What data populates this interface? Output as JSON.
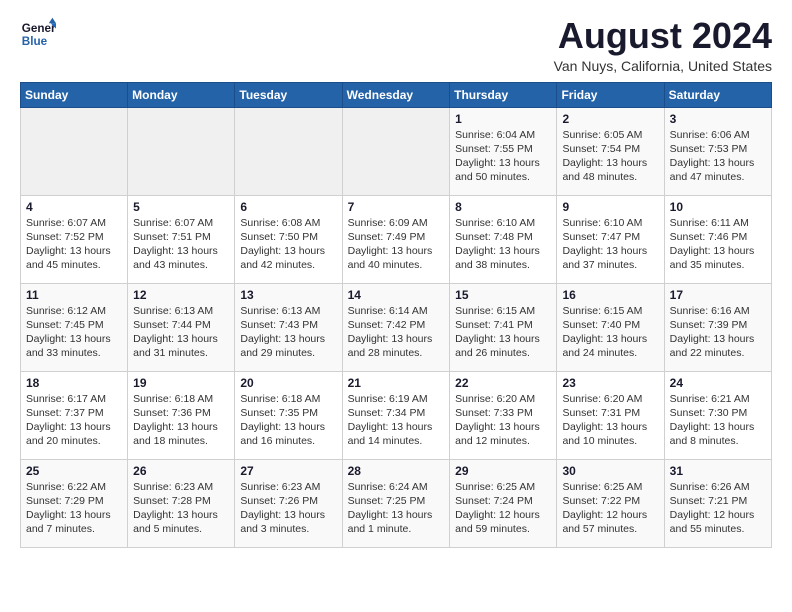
{
  "logo": {
    "line1": "General",
    "line2": "Blue"
  },
  "header": {
    "month": "August 2024",
    "location": "Van Nuys, California, United States"
  },
  "weekdays": [
    "Sunday",
    "Monday",
    "Tuesday",
    "Wednesday",
    "Thursday",
    "Friday",
    "Saturday"
  ],
  "weeks": [
    [
      {
        "day": "",
        "info": ""
      },
      {
        "day": "",
        "info": ""
      },
      {
        "day": "",
        "info": ""
      },
      {
        "day": "",
        "info": ""
      },
      {
        "day": "1",
        "info": "Sunrise: 6:04 AM\nSunset: 7:55 PM\nDaylight: 13 hours\nand 50 minutes."
      },
      {
        "day": "2",
        "info": "Sunrise: 6:05 AM\nSunset: 7:54 PM\nDaylight: 13 hours\nand 48 minutes."
      },
      {
        "day": "3",
        "info": "Sunrise: 6:06 AM\nSunset: 7:53 PM\nDaylight: 13 hours\nand 47 minutes."
      }
    ],
    [
      {
        "day": "4",
        "info": "Sunrise: 6:07 AM\nSunset: 7:52 PM\nDaylight: 13 hours\nand 45 minutes."
      },
      {
        "day": "5",
        "info": "Sunrise: 6:07 AM\nSunset: 7:51 PM\nDaylight: 13 hours\nand 43 minutes."
      },
      {
        "day": "6",
        "info": "Sunrise: 6:08 AM\nSunset: 7:50 PM\nDaylight: 13 hours\nand 42 minutes."
      },
      {
        "day": "7",
        "info": "Sunrise: 6:09 AM\nSunset: 7:49 PM\nDaylight: 13 hours\nand 40 minutes."
      },
      {
        "day": "8",
        "info": "Sunrise: 6:10 AM\nSunset: 7:48 PM\nDaylight: 13 hours\nand 38 minutes."
      },
      {
        "day": "9",
        "info": "Sunrise: 6:10 AM\nSunset: 7:47 PM\nDaylight: 13 hours\nand 37 minutes."
      },
      {
        "day": "10",
        "info": "Sunrise: 6:11 AM\nSunset: 7:46 PM\nDaylight: 13 hours\nand 35 minutes."
      }
    ],
    [
      {
        "day": "11",
        "info": "Sunrise: 6:12 AM\nSunset: 7:45 PM\nDaylight: 13 hours\nand 33 minutes."
      },
      {
        "day": "12",
        "info": "Sunrise: 6:13 AM\nSunset: 7:44 PM\nDaylight: 13 hours\nand 31 minutes."
      },
      {
        "day": "13",
        "info": "Sunrise: 6:13 AM\nSunset: 7:43 PM\nDaylight: 13 hours\nand 29 minutes."
      },
      {
        "day": "14",
        "info": "Sunrise: 6:14 AM\nSunset: 7:42 PM\nDaylight: 13 hours\nand 28 minutes."
      },
      {
        "day": "15",
        "info": "Sunrise: 6:15 AM\nSunset: 7:41 PM\nDaylight: 13 hours\nand 26 minutes."
      },
      {
        "day": "16",
        "info": "Sunrise: 6:15 AM\nSunset: 7:40 PM\nDaylight: 13 hours\nand 24 minutes."
      },
      {
        "day": "17",
        "info": "Sunrise: 6:16 AM\nSunset: 7:39 PM\nDaylight: 13 hours\nand 22 minutes."
      }
    ],
    [
      {
        "day": "18",
        "info": "Sunrise: 6:17 AM\nSunset: 7:37 PM\nDaylight: 13 hours\nand 20 minutes."
      },
      {
        "day": "19",
        "info": "Sunrise: 6:18 AM\nSunset: 7:36 PM\nDaylight: 13 hours\nand 18 minutes."
      },
      {
        "day": "20",
        "info": "Sunrise: 6:18 AM\nSunset: 7:35 PM\nDaylight: 13 hours\nand 16 minutes."
      },
      {
        "day": "21",
        "info": "Sunrise: 6:19 AM\nSunset: 7:34 PM\nDaylight: 13 hours\nand 14 minutes."
      },
      {
        "day": "22",
        "info": "Sunrise: 6:20 AM\nSunset: 7:33 PM\nDaylight: 13 hours\nand 12 minutes."
      },
      {
        "day": "23",
        "info": "Sunrise: 6:20 AM\nSunset: 7:31 PM\nDaylight: 13 hours\nand 10 minutes."
      },
      {
        "day": "24",
        "info": "Sunrise: 6:21 AM\nSunset: 7:30 PM\nDaylight: 13 hours\nand 8 minutes."
      }
    ],
    [
      {
        "day": "25",
        "info": "Sunrise: 6:22 AM\nSunset: 7:29 PM\nDaylight: 13 hours\nand 7 minutes."
      },
      {
        "day": "26",
        "info": "Sunrise: 6:23 AM\nSunset: 7:28 PM\nDaylight: 13 hours\nand 5 minutes."
      },
      {
        "day": "27",
        "info": "Sunrise: 6:23 AM\nSunset: 7:26 PM\nDaylight: 13 hours\nand 3 minutes."
      },
      {
        "day": "28",
        "info": "Sunrise: 6:24 AM\nSunset: 7:25 PM\nDaylight: 13 hours\nand 1 minute."
      },
      {
        "day": "29",
        "info": "Sunrise: 6:25 AM\nSunset: 7:24 PM\nDaylight: 12 hours\nand 59 minutes."
      },
      {
        "day": "30",
        "info": "Sunrise: 6:25 AM\nSunset: 7:22 PM\nDaylight: 12 hours\nand 57 minutes."
      },
      {
        "day": "31",
        "info": "Sunrise: 6:26 AM\nSunset: 7:21 PM\nDaylight: 12 hours\nand 55 minutes."
      }
    ]
  ]
}
